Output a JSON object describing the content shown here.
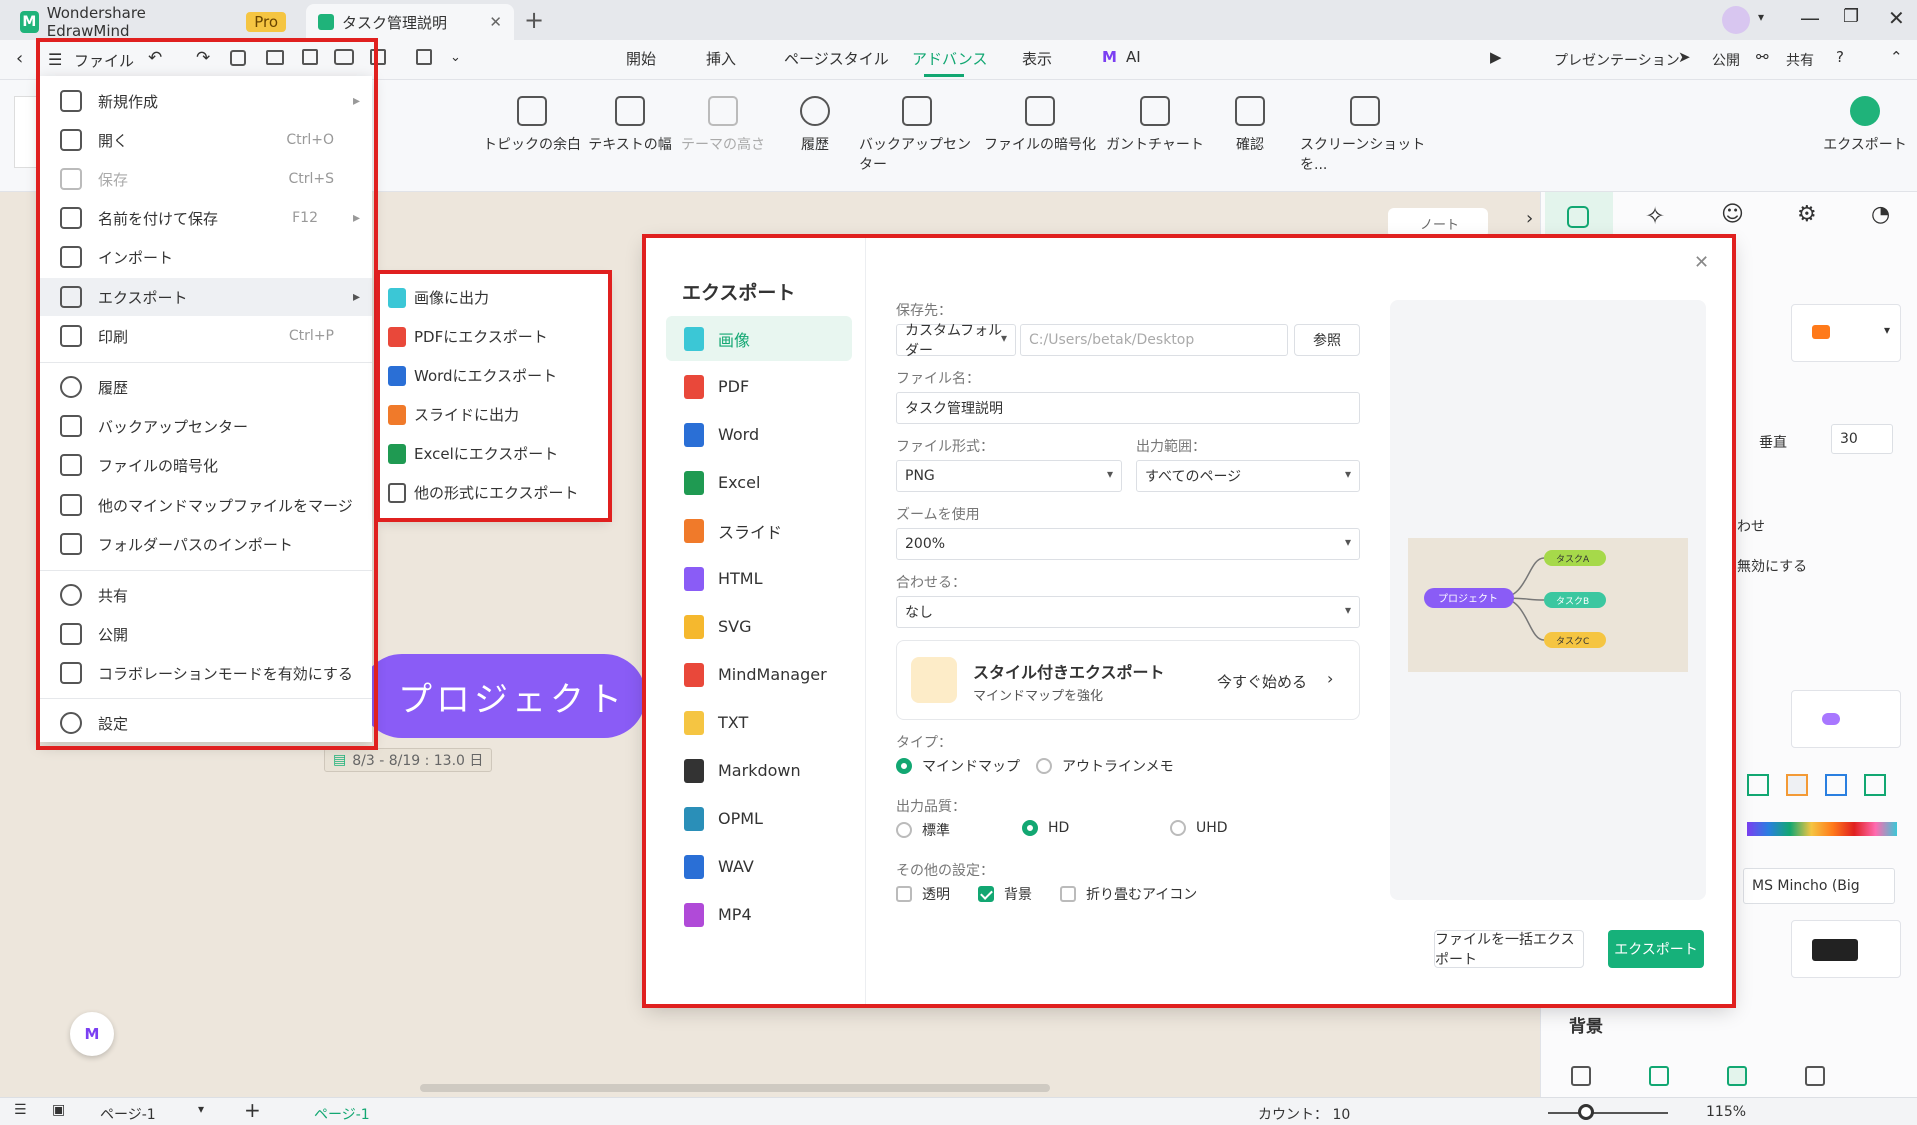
{
  "app": {
    "title": "Wondershare EdrawMind",
    "badge": "Pro"
  },
  "doc_tab": {
    "title": "タスク管理説明"
  },
  "quick": {
    "file_label": "ファイル"
  },
  "menu_tabs": [
    "開始",
    "挿入",
    "ページスタイル",
    "アドバンス",
    "表示",
    "AI"
  ],
  "menu_right": {
    "present": "プレゼンテーション",
    "publish": "公開",
    "share": "共有"
  },
  "ribbon": [
    "トピックの余白",
    "テキストの幅",
    "テーマの高さ",
    "履歴",
    "バックアップセンター",
    "ファイルの暗号化",
    "ガントチャート",
    "確認",
    "スクリーンショットを...",
    "エクスポート"
  ],
  "file_menu": [
    {
      "label": "新規作成",
      "shortcut": ""
    },
    {
      "label": "開く",
      "shortcut": "Ctrl+O"
    },
    {
      "label": "保存",
      "shortcut": "Ctrl+S"
    },
    {
      "label": "名前を付けて保存",
      "shortcut": "F12"
    },
    {
      "label": "インポート",
      "shortcut": ""
    },
    {
      "label": "エクスポート",
      "shortcut": ""
    },
    {
      "label": "印刷",
      "shortcut": "Ctrl+P"
    },
    {
      "label": "履歴",
      "shortcut": ""
    },
    {
      "label": "バックアップセンター",
      "shortcut": ""
    },
    {
      "label": "ファイルの暗号化",
      "shortcut": ""
    },
    {
      "label": "他のマインドマップファイルをマージ",
      "shortcut": ""
    },
    {
      "label": "フォルダーパスのインポート",
      "shortcut": ""
    },
    {
      "label": "共有",
      "shortcut": ""
    },
    {
      "label": "公開",
      "shortcut": ""
    },
    {
      "label": "コラボレーションモードを有効にする",
      "shortcut": ""
    },
    {
      "label": "設定",
      "shortcut": ""
    }
  ],
  "export_submenu": [
    "画像に出力",
    "PDFにエクスポート",
    "Wordにエクスポート",
    "スライドに出力",
    "Excelにエクスポート",
    "他の形式にエクスポート"
  ],
  "dialog": {
    "title": "エクスポート",
    "formats": [
      "画像",
      "PDF",
      "Word",
      "Excel",
      "スライド",
      "HTML",
      "SVG",
      "MindManager",
      "TXT",
      "Markdown",
      "OPML",
      "WAV",
      "MP4"
    ],
    "save_to_label": "保存先：",
    "folder_select": "カスタムフォルダー",
    "path": "C:/Users/betak/Desktop",
    "browse": "参照",
    "filename_label": "ファイル名：",
    "filename": "タスク管理説明",
    "format_label": "ファイル形式：",
    "format_value": "PNG",
    "range_label": "出力範囲：",
    "range_value": "すべてのページ",
    "zoom_label": "ズームを使用",
    "zoom_value": "200%",
    "fit_label": "合わせる：",
    "fit_value": "なし",
    "promo_title": "スタイル付きエクスポート",
    "promo_sub": "マインドマップを強化",
    "promo_cta": "今すぐ始める",
    "type_label": "タイプ：",
    "type_opts": [
      "マインドマップ",
      "アウトラインメモ"
    ],
    "quality_label": "出力品質：",
    "quality_opts": [
      "標準",
      "HD",
      "UHD"
    ],
    "other_label": "その他の設定：",
    "other_opts": [
      "透明",
      "背景",
      "折り畳むアイコン"
    ],
    "batch_btn": "ファイルを一括エクスポート",
    "export_btn": "エクスポート"
  },
  "canvas": {
    "root": "プロジェクト",
    "date": "8/3 - 8/19 : 13.0 日",
    "note_tab": "ノート"
  },
  "preview": {
    "root": "プロジェクト",
    "nodes": [
      "タスクA",
      "タスクB",
      "タスクC"
    ]
  },
  "right_panel": {
    "vertical_label": "垂直",
    "vertical_value": "30",
    "cut1": "わせ",
    "cut2": "無効にする",
    "font": "MS Mincho (Big",
    "bg_label": "背景"
  },
  "status": {
    "page": "ページ-1",
    "page_tab": "ページ-1",
    "count": "カウント： 10",
    "zoom": "115%"
  }
}
